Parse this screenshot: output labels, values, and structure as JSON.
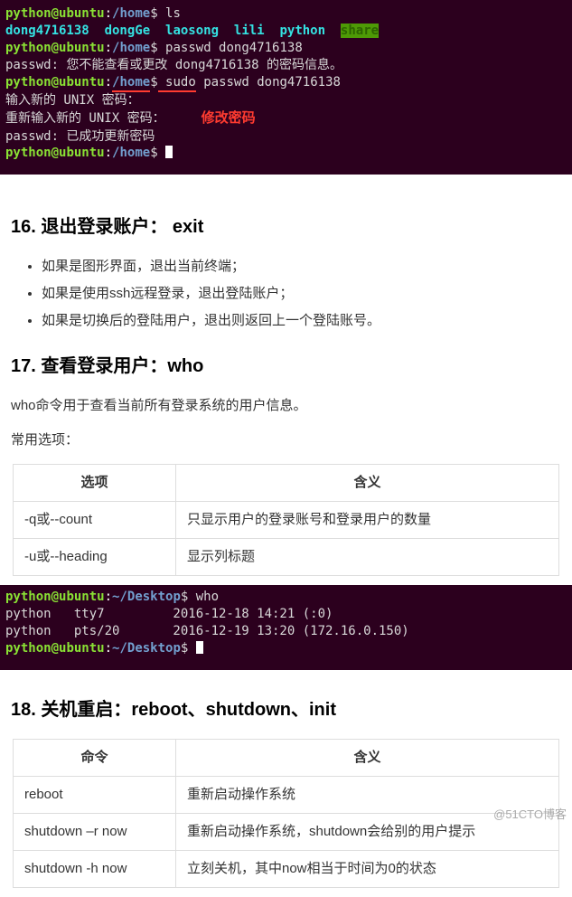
{
  "terminal1": {
    "line1": {
      "prompt_user": "python",
      "at": "@",
      "host": "ubuntu",
      "colon": ":",
      "path": "/home",
      "dollar": "$",
      "cmd": " ls"
    },
    "line2_dirs": {
      "d1": "dong4716138",
      "d2": "dongGe",
      "d3": "laosong",
      "d4": "lili",
      "d5": "python",
      "d6": "share"
    },
    "line3": {
      "prompt_user": "python",
      "at": "@",
      "host": "ubuntu",
      "colon": ":",
      "path": "/home",
      "dollar": "$",
      "cmd": " passwd dong4716138"
    },
    "line4": "passwd: 您不能查看或更改 dong4716138 的密码信息。",
    "line5": {
      "prompt_user": "python",
      "at": "@",
      "host": "ubuntu",
      "colon": ":",
      "path": "/home",
      "dollar": "$",
      "cmd1": " sudo",
      "cmd2": " passwd dong4716138"
    },
    "line6": "输入新的 UNIX 密码：",
    "line7": "重新输入新的 UNIX 密码：",
    "annotation": "修改密码",
    "line8": "passwd: 已成功更新密码",
    "line9": {
      "prompt_user": "python",
      "at": "@",
      "host": "ubuntu",
      "colon": ":",
      "path": "/home",
      "dollar": "$",
      "cmd": " "
    }
  },
  "section16": {
    "heading": "16. 退出登录账户：   exit",
    "items": [
      "如果是图形界面，退出当前终端；",
      "如果是使用ssh远程登录，退出登陆账户；",
      "如果是切换后的登陆用户，退出则返回上一个登陆账号。"
    ]
  },
  "section17": {
    "heading": "17. 查看登录用户：who",
    "para1": "who命令用于查看当前所有登录系统的用户信息。",
    "para2": "常用选项：",
    "table_head": {
      "col1": "选项",
      "col2": "含义"
    },
    "rows": [
      {
        "c1": "-q或--count",
        "c2": "只显示用户的登录账号和登录用户的数量"
      },
      {
        "c1": "-u或--heading",
        "c2": "显示列标题"
      }
    ]
  },
  "terminal2": {
    "line1": {
      "prompt_user": "python",
      "at": "@",
      "host": "ubuntu",
      "colon": ":",
      "path": "~/Desktop",
      "dollar": "$",
      "cmd": " who"
    },
    "line2": "python   tty7         2016-12-18 14:21 (:0)",
    "line3": "python   pts/20       2016-12-19 13:20 (172.16.0.150)",
    "line4": {
      "prompt_user": "python",
      "at": "@",
      "host": "ubuntu",
      "colon": ":",
      "path": "~/Desktop",
      "dollar": "$",
      "cmd": " "
    }
  },
  "section18": {
    "heading": "18. 关机重启：reboot、shutdown、init",
    "table_head": {
      "col1": "命令",
      "col2": "含义"
    },
    "rows": [
      {
        "c1": "reboot",
        "c2": "重新启动操作系统"
      },
      {
        "c1": "shutdown –r now",
        "c2": "重新启动操作系统，shutdown会给别的用户提示"
      },
      {
        "c1": "shutdown -h now",
        "c2": "立刻关机，其中now相当于时间为0的状态"
      }
    ]
  },
  "watermark": "@51CTO博客"
}
